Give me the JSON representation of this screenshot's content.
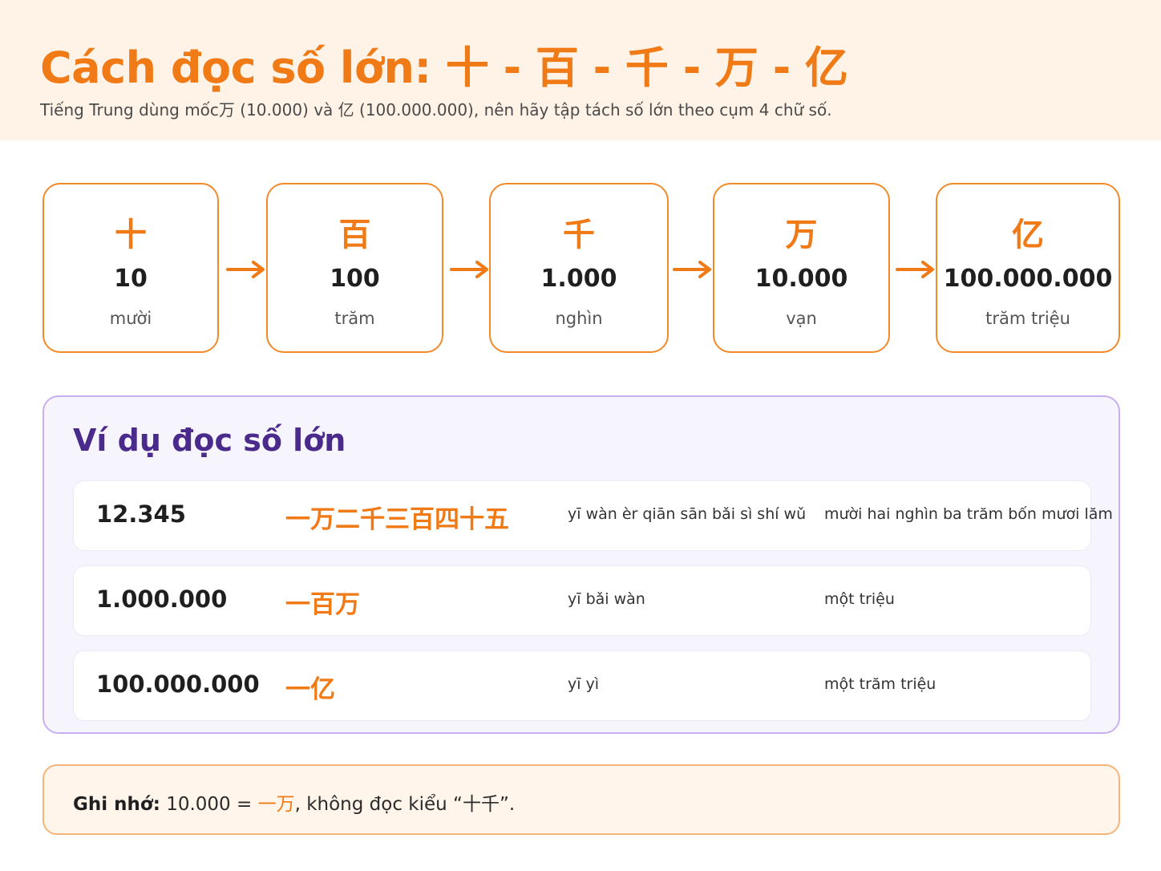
{
  "header": {
    "title": "Cách đọc số lớn: 十 - 百 - 千 - 万 - 亿",
    "subtitle": "Tiếng Trung dùng mốc万 (10.000) và 亿 (100.000.000), nên hãy tập tách số lớn theo cụm 4 chữ số."
  },
  "steps": [
    {
      "hanzi": "十",
      "number": "10",
      "vietnamese": "mười"
    },
    {
      "hanzi": "百",
      "number": "100",
      "vietnamese": "trăm"
    },
    {
      "hanzi": "千",
      "number": "1.000",
      "vietnamese": "nghìn"
    },
    {
      "hanzi": "万",
      "number": "10.000",
      "vietnamese": "vạn"
    },
    {
      "hanzi": "亿",
      "number": "100.000.000",
      "vietnamese": "trăm triệu"
    }
  ],
  "examples": {
    "title": "Ví dụ đọc số lớn",
    "rows": [
      {
        "number": "12.345",
        "hanzi": "一万二千三百四十五",
        "pinyin": "yī wàn èr qiān sān bǎi sì shí wǔ",
        "vietnamese": "mười hai nghìn ba trăm bốn mươi lăm"
      },
      {
        "number": "1.000.000",
        "hanzi": "一百万",
        "pinyin": "yī bǎi wàn",
        "vietnamese": "một triệu"
      },
      {
        "number": "100.000.000",
        "hanzi": "一亿",
        "pinyin": "yī yì",
        "vietnamese": "một trăm triệu"
      }
    ]
  },
  "note": {
    "label": "Ghi nhớ:",
    "prefix": " 10.000 = ",
    "highlight": "一万",
    "suffix": ", không đọc kiểu “十千”."
  },
  "colors": {
    "accent": "#f07a16",
    "header_bg": "#fff3e7",
    "examples_title": "#4a2a8a",
    "examples_border": "#c9aef0"
  }
}
